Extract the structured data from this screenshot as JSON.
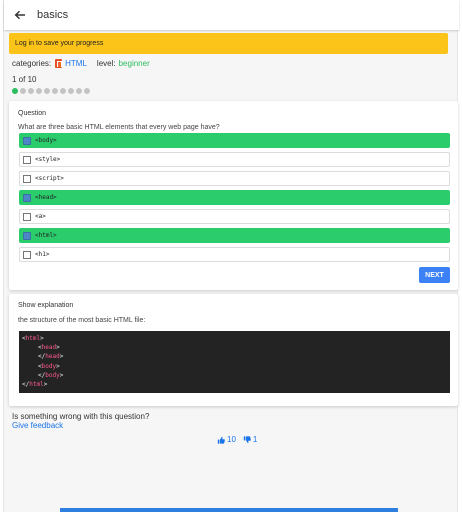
{
  "appbar": {
    "title": "basics",
    "back_icon": "arrow-left-icon"
  },
  "banner": {
    "text": "Log in to save your progress",
    "color": "#fcc419"
  },
  "meta": {
    "categories_label": "categories:",
    "category": "HTML",
    "level_label": "level:",
    "level": "beginner"
  },
  "progress": {
    "text": "1 of 10",
    "current": 1,
    "total": 10
  },
  "question": {
    "title": "Question",
    "text": "What are three basic HTML elements that every web page have?",
    "options": [
      {
        "label": "<body>",
        "selected": true
      },
      {
        "label": "<style>",
        "selected": false
      },
      {
        "label": "<script>",
        "selected": false
      },
      {
        "label": "<head>",
        "selected": true
      },
      {
        "label": "<a>",
        "selected": false
      },
      {
        "label": "<html>",
        "selected": true
      },
      {
        "label": "<h1>",
        "selected": false
      }
    ],
    "next_label": "NEXT"
  },
  "explanation": {
    "title": "Show explanation",
    "text": "the structure of the most basic HTML file:",
    "code": [
      {
        "indent": 0,
        "tag": "html",
        "close": false
      },
      {
        "indent": 1,
        "tag": "head",
        "close": false
      },
      {
        "indent": 1,
        "tag": "head",
        "close": true
      },
      {
        "indent": 1,
        "tag": "body",
        "close": false
      },
      {
        "indent": 1,
        "tag": "body",
        "close": true
      },
      {
        "indent": 0,
        "tag": "html",
        "close": true
      }
    ]
  },
  "feedback": {
    "question": "Is something wrong with this question?",
    "link": "Give feedback"
  },
  "votes": {
    "up": "10",
    "down": "1"
  },
  "colors": {
    "selected": "#2bcc6c",
    "accent": "#3c82f6",
    "link": "#1a73e8",
    "level": "#2bbd5e"
  }
}
